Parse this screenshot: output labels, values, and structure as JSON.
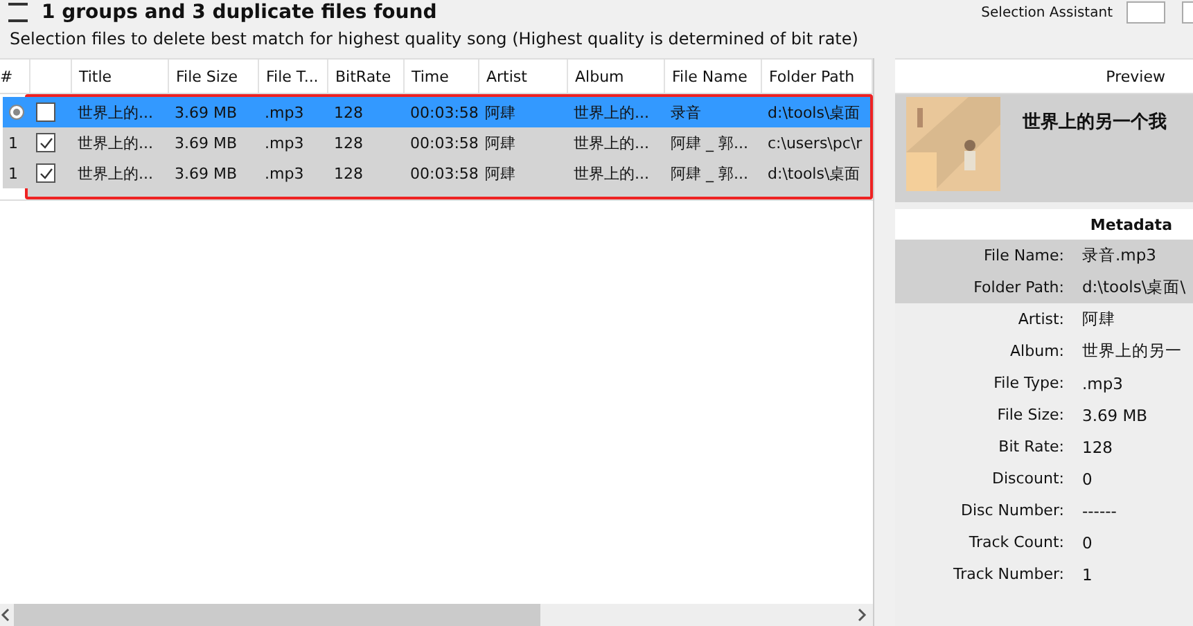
{
  "header": {
    "title": "1 groups and 3 duplicate files found",
    "assistant_label": "Selection Assistant",
    "subtitle": "Selection files to delete best match for highest quality song (Highest quality is determined of bit rate)"
  },
  "table": {
    "columns": [
      "#",
      "",
      "Title",
      "File Size",
      "File T...",
      "BitRate",
      "Time",
      "Artist",
      "Album",
      "File Name",
      "Folder Path"
    ],
    "rows": [
      {
        "checked": false,
        "selected": true,
        "cells": [
          "",
          "",
          "世界上的...",
          "3.69 MB",
          ".mp3",
          "128",
          "00:03:58",
          "阿肆",
          "世界上的...",
          "录音",
          "d:\\tools\\桌面"
        ]
      },
      {
        "checked": true,
        "selected": false,
        "cells": [
          "1",
          "",
          "世界上的...",
          "3.69 MB",
          ".mp3",
          "128",
          "00:03:58",
          "阿肆",
          "世界上的...",
          "阿肆 _ 郭...",
          "c:\\users\\pc\\r"
        ]
      },
      {
        "checked": true,
        "selected": false,
        "cells": [
          "1",
          "",
          "世界上的...",
          "3.69 MB",
          ".mp3",
          "128",
          "00:03:58",
          "阿肆",
          "世界上的...",
          "阿肆 _ 郭...",
          "d:\\tools\\桌面"
        ]
      }
    ]
  },
  "preview": {
    "heading": "Preview",
    "song_title": "世界上的另一个我",
    "metadata_heading": "Metadata",
    "fields": [
      {
        "label": "File Name:",
        "value": "录音.mp3",
        "shaded": true
      },
      {
        "label": "Folder Path:",
        "value": "d:\\tools\\桌面\\",
        "shaded": true
      },
      {
        "label": "Artist:",
        "value": "阿肆",
        "shaded": false
      },
      {
        "label": "Album:",
        "value": "世界上的另一",
        "shaded": false
      },
      {
        "label": "File Type:",
        "value": ".mp3",
        "shaded": false
      },
      {
        "label": "File Size:",
        "value": "3.69 MB",
        "shaded": false
      },
      {
        "label": "Bit Rate:",
        "value": "128",
        "shaded": false
      },
      {
        "label": "Discount:",
        "value": "0",
        "shaded": false
      },
      {
        "label": "Disc Number:",
        "value": "------",
        "shaded": false
      },
      {
        "label": "Track Count:",
        "value": "0",
        "shaded": false
      },
      {
        "label": "Track Number:",
        "value": "1",
        "shaded": false
      }
    ]
  }
}
